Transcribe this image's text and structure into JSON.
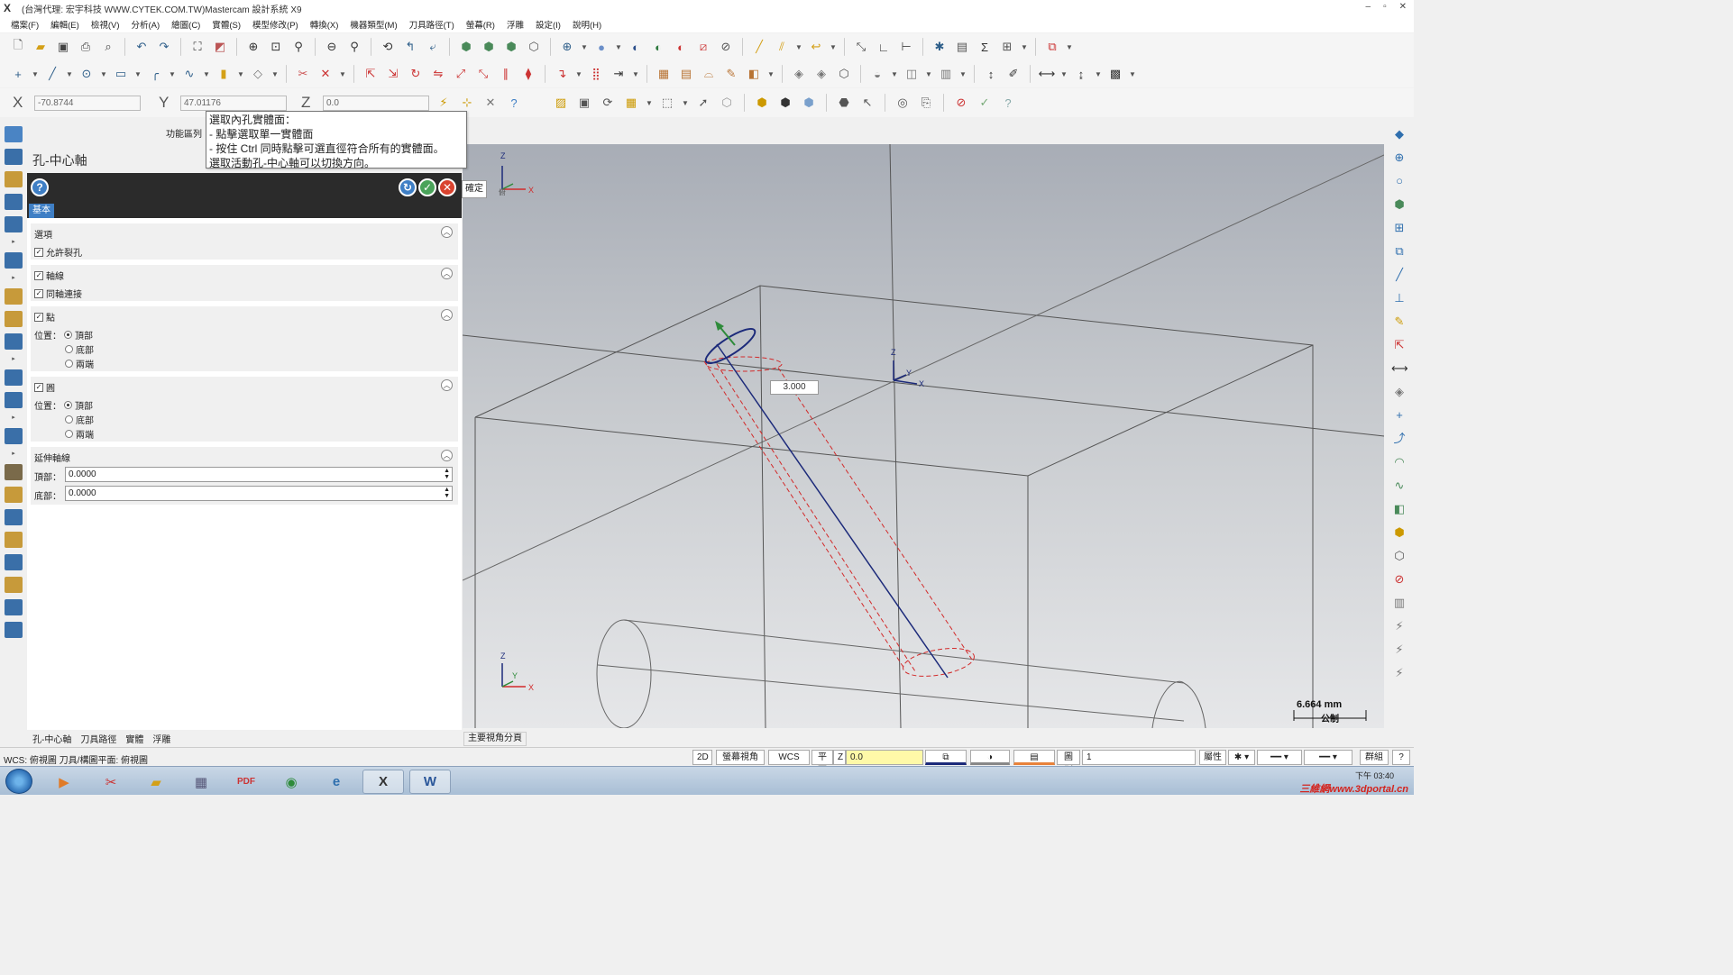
{
  "window": {
    "title": "(台灣代理: 宏宇科技 WWW.CYTEK.COM.TW)Mastercam 設計系統 X9",
    "controls": [
      "–",
      "▫",
      "✕"
    ]
  },
  "menu": [
    "檔案(F)",
    "編輯(E)",
    "檢視(V)",
    "分析(A)",
    "繪圖(C)",
    "實體(S)",
    "模型修改(P)",
    "轉換(X)",
    "機器類型(M)",
    "刀具路徑(T)",
    "螢幕(R)",
    "浮雕",
    "設定(I)",
    "說明(H)"
  ],
  "coords": {
    "x_label": "X",
    "x_value": "-70.8744",
    "y_label": "Y",
    "y_value": "47.01176",
    "z_label": "Z",
    "z_value": "0.0"
  },
  "func_area_label": "功能區列",
  "tooltip": {
    "line1": "選取內孔實體面：",
    "line2": "- 點擊選取單一實體面",
    "line3": "- 按住 Ctrl 同時點擊可選直徑符合所有的實體面。",
    "line4": "選取活動孔-中心軸可以切換方向。"
  },
  "confirm_tip": "確定",
  "panel": {
    "title": "孔-中心軸",
    "tab": "基本",
    "sections": {
      "options": {
        "title": "選項",
        "allow_split": "允許裂孔",
        "allow_split_checked": true
      },
      "axis": {
        "title": "軸線",
        "checked": true,
        "coaxial": "同軸連接",
        "coaxial_checked": true
      },
      "point": {
        "title": "點",
        "checked": true,
        "position_label": "位置：",
        "opts": [
          "頂部",
          "底部",
          "兩端"
        ],
        "selected": 0
      },
      "circle": {
        "title": "圓",
        "checked": true,
        "position_label": "位置：",
        "opts": [
          "頂部",
          "底部",
          "兩端"
        ],
        "selected": 0
      },
      "extend": {
        "title": "延伸軸線",
        "top_label": "頂部：",
        "top_value": "0.0000",
        "bottom_label": "底部：",
        "bottom_value": "0.0000"
      }
    }
  },
  "panel_tabs": [
    "孔-中心軸",
    "刀具路徑",
    "實體",
    "浮雕"
  ],
  "viewport": {
    "dimension_label": "3.000",
    "scale_value": "6.664 mm",
    "scale_unit": "公制",
    "view_tab": "主要視角分頁",
    "gnomon_top": {
      "z": "Z",
      "x": "X",
      "y": "俯"
    },
    "gnomon_center": {
      "z": "Z",
      "x": "X",
      "y": "Y"
    },
    "gnomon_bottom": {
      "z": "Z",
      "x": "X",
      "y": "Y"
    }
  },
  "status": {
    "left": "WCS: 俯視圖   刀具/構圖平面: 俯視圖",
    "mode_2d": "2D",
    "screen_view": "螢幕視角",
    "wcs": "WCS",
    "plane": "平面",
    "z_label": "Z",
    "z_value": "0.0",
    "level_label": "圖別",
    "level_value": "1",
    "attr": "屬性",
    "group": "群組",
    "help": "?"
  },
  "taskbar": {
    "time_line1": "下午 03:40",
    "watermark": "三維網www.3dportal.cn"
  },
  "colors": {
    "accent_blue": "#3f7fc5",
    "panel_header": "#2b2b2b",
    "hole_dashed": "#d22a2a",
    "axis_line": "#1c2a7a",
    "z_input_bg": "#fff9a8"
  }
}
